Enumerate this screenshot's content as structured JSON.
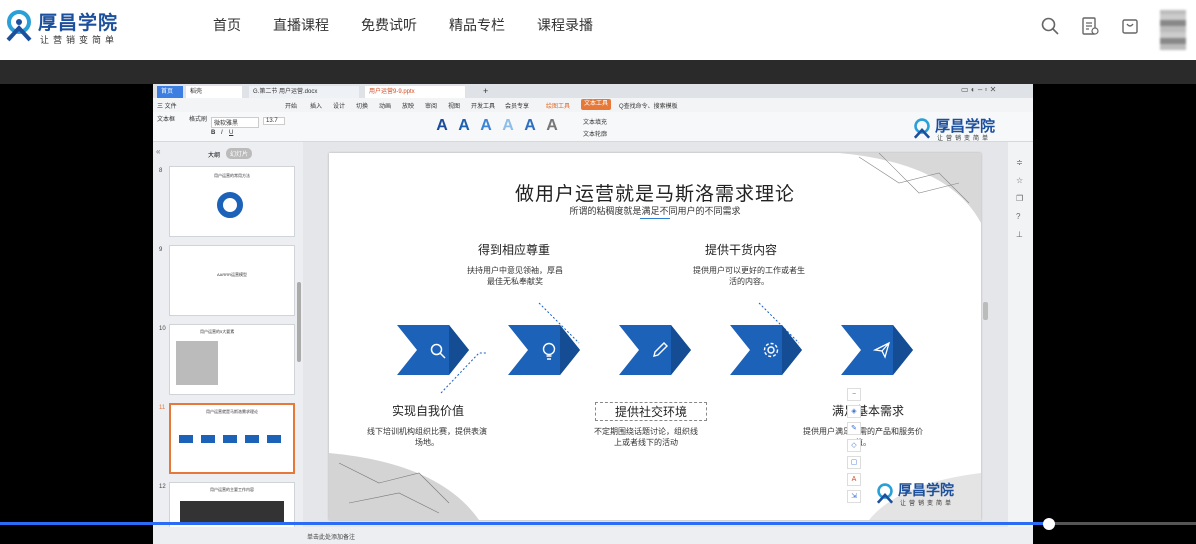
{
  "brand": {
    "name": "厚昌学院",
    "slogan": "让营销变简单"
  },
  "nav": {
    "items": [
      "首页",
      "直播课程",
      "免费试听",
      "精品专栏",
      "课程录播"
    ]
  },
  "header_icons": [
    "search-icon",
    "document-icon",
    "bag-icon",
    "avatar"
  ],
  "wps": {
    "tabs": {
      "home": "首页",
      "haoke": "稻壳",
      "doc": "G.第二节 用户运营.docx",
      "ppt": "用户运营9-9.pptx"
    },
    "menus": [
      "三 文件",
      "开始",
      "插入",
      "设计",
      "切换",
      "动画",
      "放映",
      "审阅",
      "视图",
      "开发工具",
      "会员专享",
      "绘图工具",
      "文本工具",
      "Q查找命令、搜索模板"
    ],
    "ribbon": {
      "font": "微软雅黑",
      "size": "13.7",
      "text_effects": "文本填充",
      "text_outline": "文本轮廓",
      "text_box": "文本框",
      "format": "格式刷"
    },
    "outline_tab": "大纲",
    "slides_tab": "幻灯片",
    "thumbs": [
      {
        "num": "8",
        "title": "用户运营的常用方法"
      },
      {
        "num": "9",
        "title": "AARRR运营模型"
      },
      {
        "num": "10",
        "title": "用户运营的5大要素"
      },
      {
        "num": "11",
        "title": "用户运营就是马斯洛需求理论"
      },
      {
        "num": "12",
        "title": "用户运营的主要工作内容"
      }
    ],
    "status": "单击此处添加备注",
    "add_slide": "+"
  },
  "slide": {
    "title": "做用户运营就是马斯洛需求理论",
    "subtitle": "所谓的粘稠度就是满足不同用户的不同需求",
    "items": [
      {
        "heading": "得到相应尊重",
        "desc": "扶持用户中意见领袖，厚昌最佳无私奉献奖"
      },
      {
        "heading": "提供干货内容",
        "desc": "提供用户可以更好的工作或者生活的内容。"
      },
      {
        "heading": "实现自我价值",
        "desc": "线下培训机构组织比赛，提供表演场地。"
      },
      {
        "heading": "提供社交环境",
        "desc": "不定期围绕话题讨论，组织线上或者线下的活动"
      },
      {
        "heading": "满足基本需求",
        "desc": "提供用户满足所需的产品和服务价值。"
      }
    ],
    "chevron_icons": [
      "search-icon",
      "lightbulb-icon",
      "pencil-icon",
      "gear-icon",
      "paper-plane-icon"
    ],
    "logo": {
      "name": "厚昌学院",
      "slogan": "让营销变简单"
    }
  },
  "player": {
    "progress": 0.877
  },
  "colors": {
    "accent": "#1c62b9",
    "brand": "#1c4f9c",
    "progress": "#2a6df4"
  }
}
